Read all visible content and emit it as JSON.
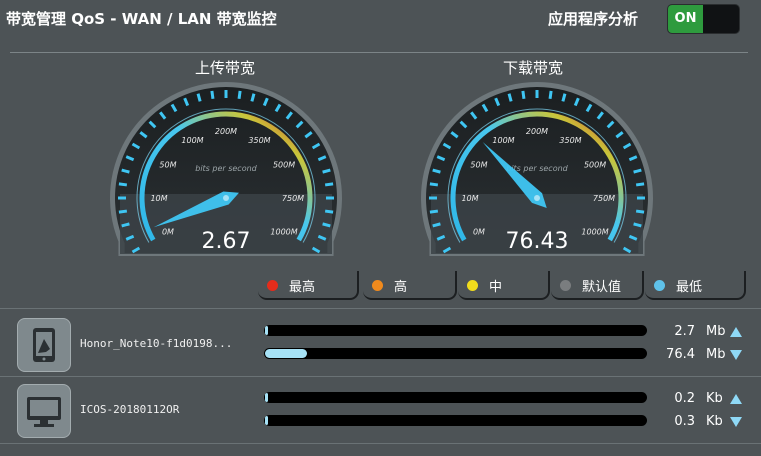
{
  "header": {
    "title": "带宽管理 QoS - WAN / LAN 带宽监控",
    "app_analysis_label": "应用程序分析",
    "toggle_state": "ON"
  },
  "gauges": [
    {
      "title": "上传带宽",
      "value": "2.67",
      "numeric_value": 2.67,
      "unit_label": "bits per second",
      "scale": [
        "0M",
        "10M",
        "50M",
        "100M",
        "200M",
        "350M",
        "500M",
        "750M",
        "1000M"
      ]
    },
    {
      "title": "下载带宽",
      "value": "76.43",
      "numeric_value": 76.43,
      "unit_label": "bits per second",
      "scale": [
        "0M",
        "10M",
        "50M",
        "100M",
        "200M",
        "350M",
        "500M",
        "750M",
        "1000M"
      ]
    }
  ],
  "priority_legend": [
    {
      "label": "最高",
      "color": "#e52c1b"
    },
    {
      "label": "高",
      "color": "#f08a1d"
    },
    {
      "label": "中",
      "color": "#f1dc1c"
    },
    {
      "label": "默认值",
      "color": "#7a7d7f"
    },
    {
      "label": "最低",
      "color": "#5fc2ea"
    }
  ],
  "devices": [
    {
      "name": "Honor_Note10-f1d0198...",
      "icon": "phone-icon",
      "upload": {
        "value": "2.7",
        "unit": "Mb",
        "fill_fraction": 0.005
      },
      "download": {
        "value": "76.4",
        "unit": "Mb",
        "fill_fraction": 0.11
      }
    },
    {
      "name": "ICOS-20180112OR",
      "icon": "computer-icon",
      "upload": {
        "value": "0.2",
        "unit": "Kb",
        "fill_fraction": 0.005
      },
      "download": {
        "value": "0.3",
        "unit": "Kb",
        "fill_fraction": 0.005
      }
    }
  ],
  "colors": {
    "background": "#4d5356",
    "accent_cyan": "#3fc6f3",
    "bar_fill": "#a6e2f6",
    "toggle_on": "#2e9b3e"
  }
}
